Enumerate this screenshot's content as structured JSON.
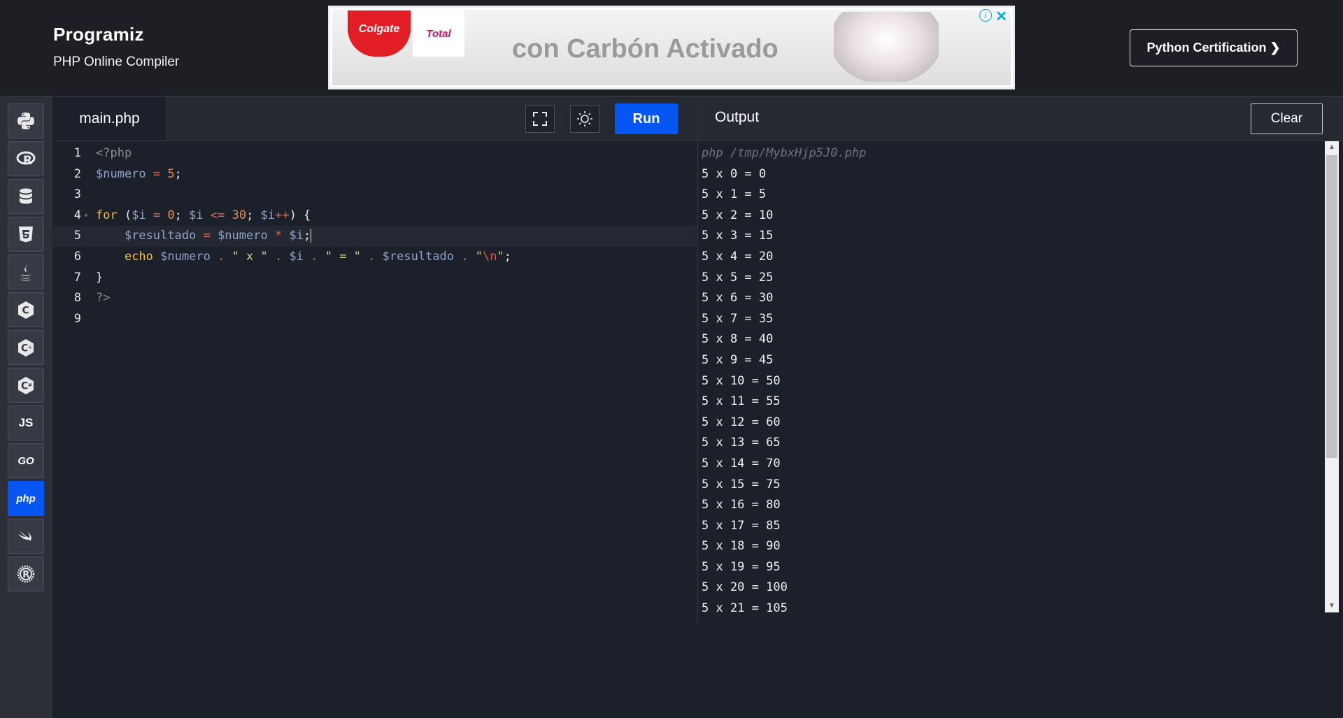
{
  "header": {
    "logo": "Programiz",
    "subtitle": "PHP Online Compiler",
    "cert_button": "Python Certification ❯",
    "ad": {
      "brand1": "Colgate",
      "brand2": "Total",
      "text": "con Carbón Activado"
    }
  },
  "sidebar": {
    "items": [
      {
        "name": "python",
        "icon": "python-icon",
        "active": false
      },
      {
        "name": "r",
        "icon": "r-icon",
        "active": false
      },
      {
        "name": "sql",
        "icon": "database-icon",
        "active": false
      },
      {
        "name": "html",
        "icon": "html5-icon",
        "active": false
      },
      {
        "name": "java",
        "icon": "java-icon",
        "active": false
      },
      {
        "name": "c",
        "icon": "c-icon",
        "active": false
      },
      {
        "name": "cpp",
        "icon": "cpp-icon",
        "active": false
      },
      {
        "name": "csharp",
        "icon": "csharp-icon",
        "active": false
      },
      {
        "name": "js",
        "label": "JS",
        "active": false
      },
      {
        "name": "go",
        "label": "GO",
        "active": false
      },
      {
        "name": "php",
        "label": "php",
        "active": true
      },
      {
        "name": "swift",
        "icon": "swift-icon",
        "active": false
      },
      {
        "name": "rust",
        "icon": "rust-icon",
        "active": false
      }
    ]
  },
  "editor": {
    "file_tab": "main.php",
    "run_label": "Run",
    "line_numbers": [
      "1",
      "2",
      "3",
      "4",
      "5",
      "6",
      "7",
      "8",
      "9"
    ],
    "lines": [
      "<?php",
      "$numero = 5;",
      "",
      "for ($i = 0; $i <= 30; $i++) {",
      "    $resultado = $numero * $i;",
      "    echo $numero . \" x \" . $i . \" = \" . $resultado . \"\\n\";",
      "}",
      "?>",
      ""
    ]
  },
  "output": {
    "title": "Output",
    "clear_label": "Clear",
    "command": "php /tmp/MybxHjp5J0.php",
    "lines": [
      "5 x 0 = 0",
      "5 x 1 = 5",
      "5 x 2 = 10",
      "5 x 3 = 15",
      "5 x 4 = 20",
      "5 x 5 = 25",
      "5 x 6 = 30",
      "5 x 7 = 35",
      "5 x 8 = 40",
      "5 x 9 = 45",
      "5 x 10 = 50",
      "5 x 11 = 55",
      "5 x 12 = 60",
      "5 x 13 = 65",
      "5 x 14 = 70",
      "5 x 15 = 75",
      "5 x 16 = 80",
      "5 x 17 = 85",
      "5 x 18 = 90",
      "5 x 19 = 95",
      "5 x 20 = 100",
      "5 x 21 = 105"
    ]
  },
  "colors": {
    "accent": "#0556f3",
    "background": "#1c202a",
    "header": "#1d1f25"
  }
}
